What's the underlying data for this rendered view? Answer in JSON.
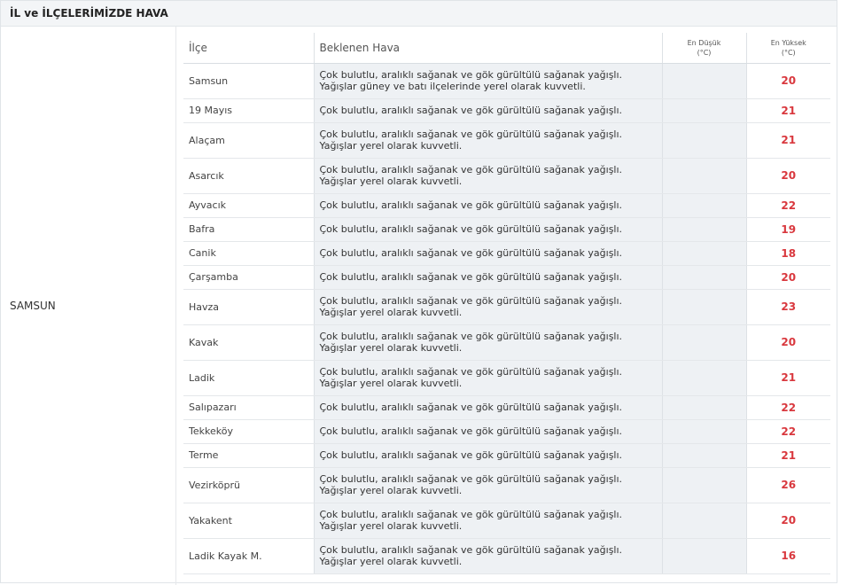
{
  "panel": {
    "title": "İL ve İLÇELERİMİZDE HAVA"
  },
  "province": "SAMSUN",
  "table": {
    "headers": {
      "district": "İlçe",
      "weather": "Beklenen Hava",
      "min": "En Düşük",
      "min_unit": "(°C)",
      "max": "En Yüksek",
      "max_unit": "(°C)"
    },
    "rows": [
      {
        "district": "Samsun",
        "weather": "Çok bulutlu, aralıklı sağanak ve gök gürültülü sağanak yağışlı. Yağışlar güney ve batı ilçelerinde yerel olarak kuvvetli.",
        "min": "",
        "max": "20",
        "lines": 2
      },
      {
        "district": "19 Mayıs",
        "weather": "Çok bulutlu, aralıklı sağanak ve gök gürültülü sağanak yağışlı.",
        "min": "",
        "max": "21",
        "lines": 1
      },
      {
        "district": "Alaçam",
        "weather": "Çok bulutlu, aralıklı sağanak ve gök gürültülü sağanak yağışlı. Yağışlar yerel olarak kuvvetli.",
        "min": "",
        "max": "21",
        "lines": 2
      },
      {
        "district": "Asarcık",
        "weather": "Çok bulutlu, aralıklı sağanak ve gök gürültülü sağanak yağışlı. Yağışlar yerel olarak kuvvetli.",
        "min": "",
        "max": "20",
        "lines": 2
      },
      {
        "district": "Ayvacık",
        "weather": "Çok bulutlu, aralıklı sağanak ve gök gürültülü sağanak yağışlı.",
        "min": "",
        "max": "22",
        "lines": 1
      },
      {
        "district": "Bafra",
        "weather": "Çok bulutlu, aralıklı sağanak ve gök gürültülü sağanak yağışlı.",
        "min": "",
        "max": "19",
        "lines": 1
      },
      {
        "district": "Canik",
        "weather": "Çok bulutlu, aralıklı sağanak ve gök gürültülü sağanak yağışlı.",
        "min": "",
        "max": "18",
        "lines": 1
      },
      {
        "district": "Çarşamba",
        "weather": "Çok bulutlu, aralıklı sağanak ve gök gürültülü sağanak yağışlı.",
        "min": "",
        "max": "20",
        "lines": 1
      },
      {
        "district": "Havza",
        "weather": "Çok bulutlu, aralıklı sağanak ve gök gürültülü sağanak yağışlı. Yağışlar yerel olarak kuvvetli.",
        "min": "",
        "max": "23",
        "lines": 2
      },
      {
        "district": "Kavak",
        "weather": "Çok bulutlu, aralıklı sağanak ve gök gürültülü sağanak yağışlı. Yağışlar yerel olarak kuvvetli.",
        "min": "",
        "max": "20",
        "lines": 2
      },
      {
        "district": "Ladik",
        "weather": "Çok bulutlu, aralıklı sağanak ve gök gürültülü sağanak yağışlı. Yağışlar yerel olarak kuvvetli.",
        "min": "",
        "max": "21",
        "lines": 2
      },
      {
        "district": "Salıpazarı",
        "weather": "Çok bulutlu, aralıklı sağanak ve gök gürültülü sağanak yağışlı.",
        "min": "",
        "max": "22",
        "lines": 1
      },
      {
        "district": "Tekkeköy",
        "weather": "Çok bulutlu, aralıklı sağanak ve gök gürültülü sağanak yağışlı.",
        "min": "",
        "max": "22",
        "lines": 1
      },
      {
        "district": "Terme",
        "weather": "Çok bulutlu, aralıklı sağanak ve gök gürültülü sağanak yağışlı.",
        "min": "",
        "max": "21",
        "lines": 1
      },
      {
        "district": "Vezirköprü",
        "weather": "Çok bulutlu, aralıklı sağanak ve gök gürültülü sağanak yağışlı. Yağışlar yerel olarak kuvvetli.",
        "min": "",
        "max": "26",
        "lines": 2
      },
      {
        "district": "Yakakent",
        "weather": "Çok bulutlu, aralıklı sağanak ve gök gürültülü sağanak yağışlı. Yağışlar yerel olarak kuvvetli.",
        "min": "",
        "max": "20",
        "lines": 2
      },
      {
        "district": "Ladik Kayak M.",
        "weather": "Çok bulutlu, aralıklı sağanak ve gök gürültülü sağanak yağışlı. Yağışlar yerel olarak kuvvetli.",
        "min": "",
        "max": "16",
        "lines": 2
      }
    ]
  },
  "colors": {
    "max_temp": "#d9383e",
    "header_bg": "#f3f5f7",
    "cell_shade": "#eef1f4"
  }
}
